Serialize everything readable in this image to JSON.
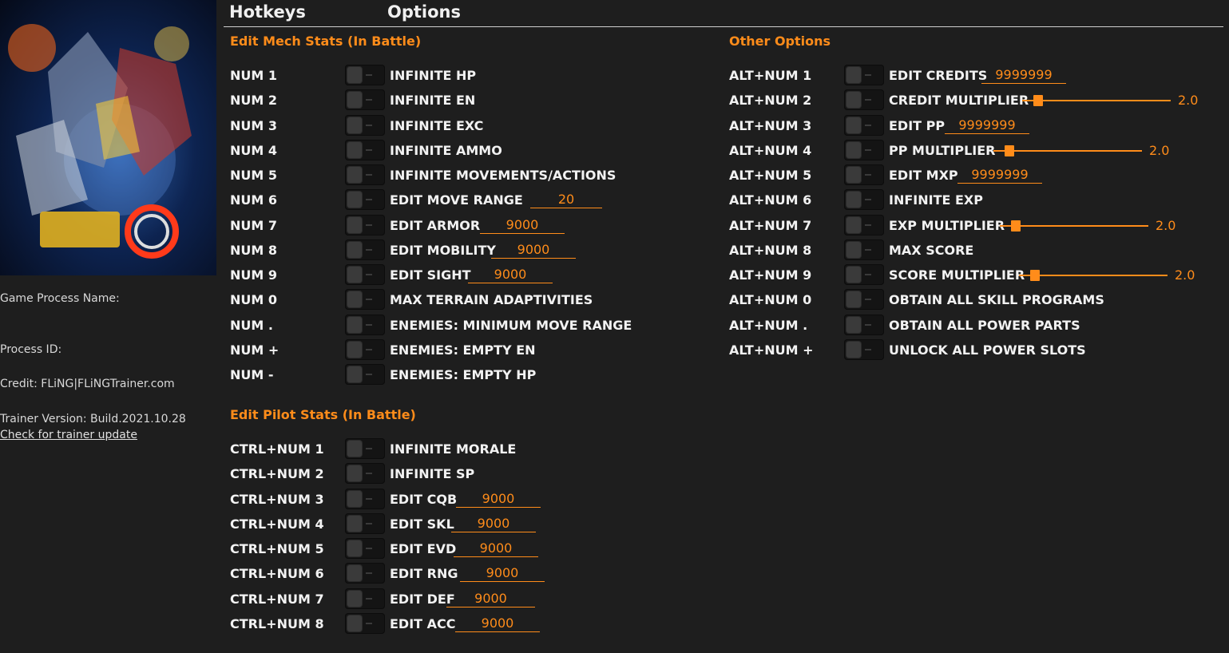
{
  "tabs": {
    "hotkeys": "Hotkeys",
    "options": "Options"
  },
  "info": {
    "process_name": "Game Process Name:",
    "process_id": "Process ID:",
    "credit": "Credit: FLiNG|FLiNGTrainer.com",
    "version": "Trainer Version: Build.2021.10.28",
    "update_link": "Check for trainer update"
  },
  "colors": {
    "accent": "#ff8c1a",
    "background": "#1e1e1e",
    "text": "#f2f2f2"
  },
  "sections": {
    "mech": {
      "title": "Edit Mech Stats (In Battle)",
      "rows": [
        {
          "hotkey": "NUM 1",
          "label": "INFINITE HP"
        },
        {
          "hotkey": "NUM 2",
          "label": "INFINITE EN"
        },
        {
          "hotkey": "NUM 3",
          "label": "INFINITE EXC"
        },
        {
          "hotkey": "NUM 4",
          "label": "INFINITE AMMO"
        },
        {
          "hotkey": "NUM 5",
          "label": "INFINITE MOVEMENTS/ACTIONS"
        },
        {
          "hotkey": "NUM 6",
          "label": "EDIT MOVE RANGE",
          "value": "20"
        },
        {
          "hotkey": "NUM 7",
          "label": "EDIT ARMOR",
          "value": "9000"
        },
        {
          "hotkey": "NUM 8",
          "label": "EDIT MOBILITY",
          "value": "9000"
        },
        {
          "hotkey": "NUM 9",
          "label": "EDIT SIGHT",
          "value": "9000"
        },
        {
          "hotkey": "NUM 0",
          "label": "MAX TERRAIN ADAPTIVITIES"
        },
        {
          "hotkey": "NUM .",
          "label": "ENEMIES: MINIMUM MOVE RANGE"
        },
        {
          "hotkey": "NUM +",
          "label": "ENEMIES: EMPTY EN"
        },
        {
          "hotkey": "NUM -",
          "label": "ENEMIES: EMPTY HP"
        }
      ]
    },
    "pilot": {
      "title": "Edit Pilot Stats (In Battle)",
      "rows": [
        {
          "hotkey": "CTRL+NUM 1",
          "label": "INFINITE MORALE"
        },
        {
          "hotkey": "CTRL+NUM 2",
          "label": "INFINITE SP"
        },
        {
          "hotkey": "CTRL+NUM 3",
          "label": "EDIT CQB",
          "value": "9000"
        },
        {
          "hotkey": "CTRL+NUM 4",
          "label": "EDIT SKL",
          "value": "9000"
        },
        {
          "hotkey": "CTRL+NUM 5",
          "label": "EDIT EVD",
          "value": "9000"
        },
        {
          "hotkey": "CTRL+NUM 6",
          "label": "EDIT RNG",
          "value": "9000"
        },
        {
          "hotkey": "CTRL+NUM 7",
          "label": "EDIT DEF",
          "value": "9000"
        },
        {
          "hotkey": "CTRL+NUM 8",
          "label": "EDIT ACC",
          "value": "9000"
        }
      ]
    },
    "other": {
      "title": "Other Options",
      "rows": [
        {
          "hotkey": "ALT+NUM 1",
          "label": "EDIT CREDITS",
          "value": "9999999"
        },
        {
          "hotkey": "ALT+NUM 2",
          "label": "CREDIT MULTIPLIER",
          "slider": "2.0"
        },
        {
          "hotkey": "ALT+NUM 3",
          "label": "EDIT PP",
          "value": "9999999"
        },
        {
          "hotkey": "ALT+NUM 4",
          "label": "PP MULTIPLIER",
          "slider": "2.0"
        },
        {
          "hotkey": "ALT+NUM 5",
          "label": "EDIT MXP",
          "value": "9999999"
        },
        {
          "hotkey": "ALT+NUM 6",
          "label": "INFINITE EXP"
        },
        {
          "hotkey": "ALT+NUM 7",
          "label": "EXP MULTIPLIER",
          "slider": "2.0"
        },
        {
          "hotkey": "ALT+NUM 8",
          "label": "MAX SCORE"
        },
        {
          "hotkey": "ALT+NUM 9",
          "label": "SCORE MULTIPLIER",
          "slider": "2.0"
        },
        {
          "hotkey": "ALT+NUM 0",
          "label": "OBTAIN ALL SKILL PROGRAMS"
        },
        {
          "hotkey": "ALT+NUM .",
          "label": "OBTAIN ALL POWER PARTS"
        },
        {
          "hotkey": "ALT+NUM +",
          "label": "UNLOCK ALL POWER SLOTS"
        }
      ]
    }
  }
}
